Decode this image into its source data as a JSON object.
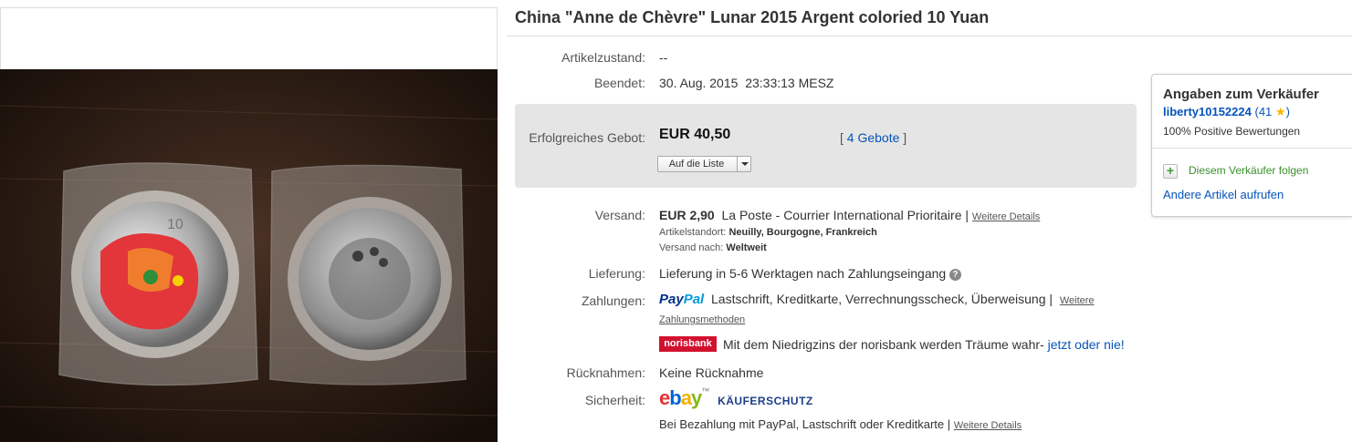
{
  "title": "China \"Anne de Chèvre\" Lunar 2015 Argent colorie​d 10 Yuan",
  "condition": {
    "label": "Artikelzustand:",
    "value": "--"
  },
  "ended": {
    "label": "Beendet:",
    "date": "30. Aug. 2015",
    "time": "23:33:13 MESZ"
  },
  "bid": {
    "label": "Erfolgreiches Gebot:",
    "amount": "EUR 40,50",
    "bids_link": "4 Gebote",
    "watch_label": "Auf die Liste"
  },
  "shipping": {
    "label": "Versand:",
    "price": "EUR 2,90",
    "service": "La Poste - Courrier International Prioritaire |",
    "details_link": "Weitere Details",
    "location_label": "Artikelstandort:",
    "location": "Neuilly, Bourgogne, Frankreich",
    "ships_to_label": "Versand nach:",
    "ships_to": "Weltweit"
  },
  "delivery": {
    "label": "Lieferung:",
    "value": "Lieferung in 5-6 Werktagen nach Zahlungseingang",
    "help_icon": "?"
  },
  "payments": {
    "label": "Zahlungen:",
    "paypal_logo_a": "Pay",
    "paypal_logo_b": "Pal",
    "methods": "Lastschrift,  Kreditkarte,  Verrechnungsscheck,  Überweisung  |",
    "more_link_a": "Weitere",
    "more_link_b": "Zahlungsmethoden",
    "norisbank_logo": "norisbank",
    "norisbank_text": "Mit dem Niedrigzins der norisbank werden Träume wahr-",
    "norisbank_link": "jetzt oder nie!"
  },
  "returns": {
    "label": "Rücknahmen:",
    "value": "Keine Rücknahme"
  },
  "security": {
    "label": "Sicherheit:",
    "ebay_e": "e",
    "ebay_b": "b",
    "ebay_a": "a",
    "ebay_y": "y",
    "tm": "™",
    "program": "KÄUFERSCHUTZ",
    "note": "Bei Bezahlung mit PayPal, Lastschrift oder Kreditkarte |",
    "details_link": "Weitere Details"
  },
  "seller": {
    "heading": "Angaben zum Verkäufer",
    "name": "liberty10152224",
    "rating": "(41",
    "rating_close": ")",
    "star": "★",
    "positive": "100% Positive Bewertungen",
    "follow": "Diesem Verkäufer folgen",
    "follow_icon": "+",
    "other_items": "Andere Artikel aufrufen"
  },
  "colors": {
    "link": "#0654ba",
    "follow_green": "#3a8e2a",
    "norisbank_red": "#d2112e"
  }
}
